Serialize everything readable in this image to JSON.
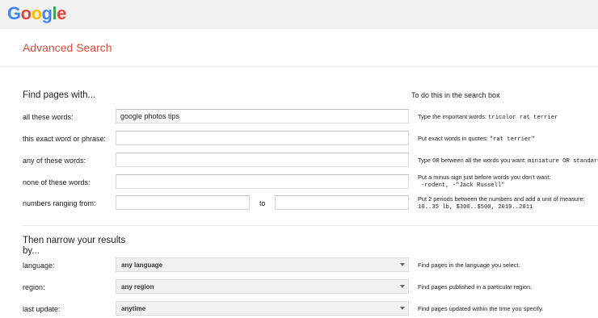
{
  "header": {
    "logo_letters": [
      {
        "ch": "G",
        "color": "#4285f4"
      },
      {
        "ch": "o",
        "color": "#ea4335"
      },
      {
        "ch": "o",
        "color": "#fbbc05"
      },
      {
        "ch": "g",
        "color": "#4285f4"
      },
      {
        "ch": "l",
        "color": "#34a853"
      },
      {
        "ch": "e",
        "color": "#ea4335"
      }
    ],
    "page_title": "Advanced Search"
  },
  "find": {
    "heading": "Find pages with...",
    "hint_heading": "To do this in the search box",
    "rows": [
      {
        "label": "all these words:",
        "value": "google photos tips"
      },
      {
        "label": "this exact word or phrase:",
        "value": ""
      },
      {
        "label": "any of these words:",
        "value": ""
      },
      {
        "label": "none of these words:",
        "value": ""
      },
      {
        "label": "numbers ranging from:",
        "value": ""
      }
    ],
    "range_to": "to",
    "range_to_value": "",
    "hints": {
      "h0_text": "Type the important words:",
      "h0_code": "tricolor rat terrier",
      "h1_text": "Put exact words in quotes:",
      "h1_code": "\"rat terrier\"",
      "h2_a": "Type",
      "h2_or1": "OR",
      "h2_b": "between all the words you want:",
      "h2_code": "miniature OR standard",
      "h3_text": "Put a minus sign just before words you don't want:",
      "h3_code": "-rodent, -\"Jack Russell\"",
      "h4_text": "Put 2 periods between the numbers and add a unit of measure:",
      "h4_code": "10..35 lb, $300..$500, 2010..2011"
    }
  },
  "narrow": {
    "heading_line1": "Then narrow your results",
    "heading_line2": "by...",
    "rows": [
      {
        "label": "language:",
        "value": "any language",
        "hint": "Find pages in the language you select."
      },
      {
        "label": "region:",
        "value": "any region",
        "hint": "Find pages published in a particular region."
      },
      {
        "label": "last update:",
        "value": "anytime",
        "hint": "Find pages updated within the time you specify."
      }
    ]
  }
}
